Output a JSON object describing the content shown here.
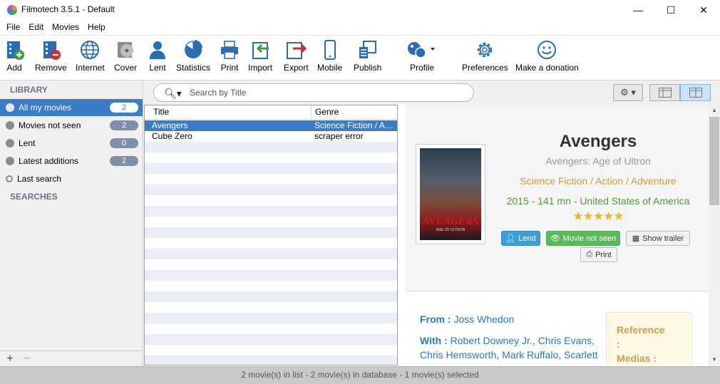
{
  "window": {
    "title": "Filmotech 3.5.1 - Default",
    "minimize_glyph": "—",
    "maximize_glyph": "☐",
    "close_glyph": "✕"
  },
  "menu": [
    "File",
    "Edit",
    "Movies",
    "Help"
  ],
  "toolbar": {
    "add": "Add",
    "remove": "Remove",
    "internet": "Internet",
    "cover": "Cover",
    "lent": "Lent",
    "statistics": "Statistics",
    "print": "Print",
    "import": "Import",
    "export": "Export",
    "mobile": "Mobile",
    "publish": "Publish",
    "profile": "Profile",
    "preferences": "Preferences",
    "donation": "Make a donation"
  },
  "sidebar": {
    "library_heading": "LIBRARY",
    "searches_heading": "SEARCHES",
    "items": [
      {
        "label": "All my movies",
        "count": "2"
      },
      {
        "label": "Movies not seen",
        "count": "2"
      },
      {
        "label": "Lent",
        "count": "0"
      },
      {
        "label": "Latest additions",
        "count": "2"
      },
      {
        "label": "Last search"
      }
    ],
    "add_glyph": "+",
    "remove_glyph": "−"
  },
  "search": {
    "placeholder": "Search by Title"
  },
  "list": {
    "columns": [
      "Title",
      "Genre"
    ],
    "rows": [
      {
        "title": "Avengers",
        "genre": "Science Fiction / Action / Adventure",
        "selected": true
      },
      {
        "title": "Cube Zero",
        "genre": "scraper error",
        "selected": false
      }
    ]
  },
  "detail": {
    "title": "Avengers",
    "original_title": "Avengers: Age of Ultron",
    "genres": "Science Fiction / Action / Adventure",
    "info": "2015 - 141 mn - United States of America",
    "rating_stars": 5,
    "stars_text": "★★★★★",
    "poster_title": "AVENGERS",
    "poster_subtitle": "AGE OF ULTRON",
    "buttons": {
      "lend": "Lend",
      "not_seen": "Movie not seen",
      "trailer": "Show trailer",
      "print": "Print"
    },
    "from_label": "From :",
    "director": "Joss Whedon",
    "with_label": "With :",
    "cast_line1": "Robert Downey Jr., Chris Evans,",
    "cast_line2": "Chris Hemsworth, Mark Ruffalo, Scarlett",
    "reference_label": "Reference",
    "reference_colon": ":",
    "medias_label": "Medias :"
  },
  "status": "2 movie(s) in list - 2 movie(s) in database - 1 movie(s) selected",
  "colors": {
    "selection": "#3c7bc6",
    "badge": "#7f8fa8",
    "genre_text": "#d29a43",
    "info_text": "#4f9a3c",
    "link_text": "#2a7ab4",
    "star": "#f0b428"
  }
}
